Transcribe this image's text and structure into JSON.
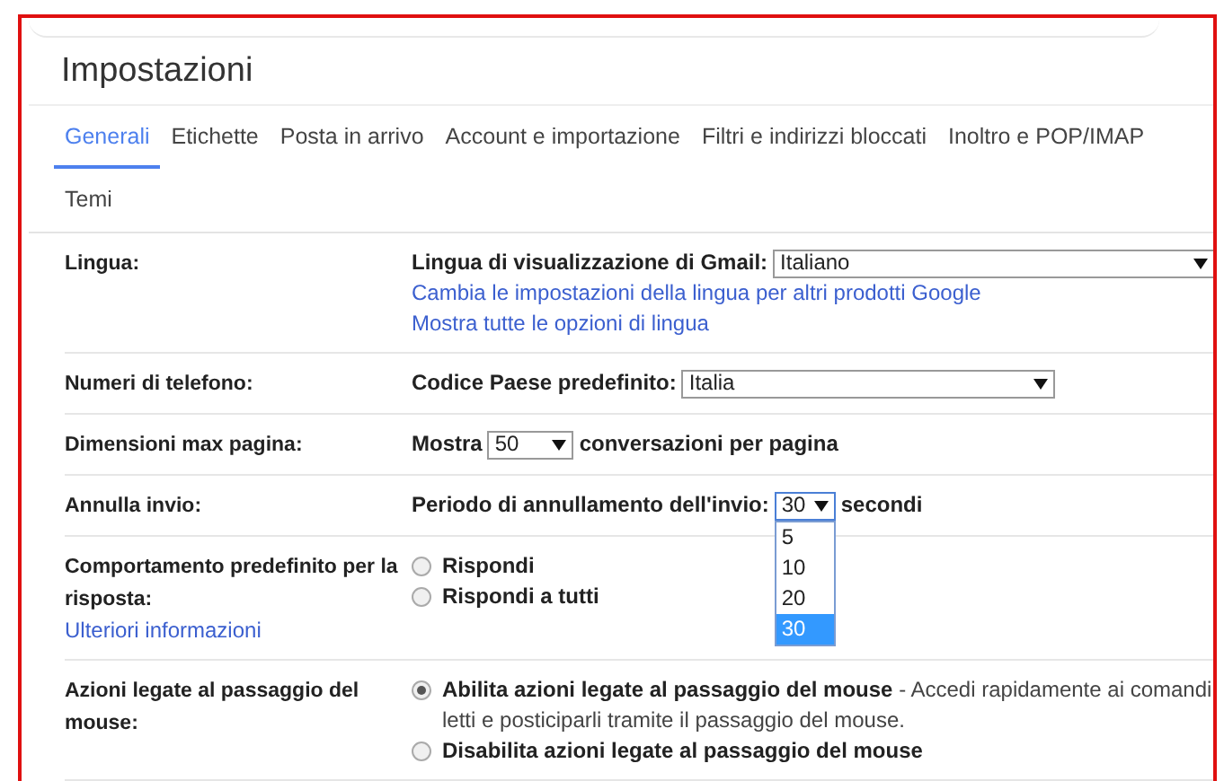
{
  "title": "Impostazioni",
  "tabs": [
    {
      "label": "Generali",
      "selected": true
    },
    {
      "label": "Etichette",
      "selected": false
    },
    {
      "label": "Posta in arrivo",
      "selected": false
    },
    {
      "label": "Account e importazione",
      "selected": false
    },
    {
      "label": "Filtri e indirizzi bloccati",
      "selected": false
    },
    {
      "label": "Inoltro e POP/IMAP",
      "selected": false
    },
    {
      "label": "Temi",
      "selected": false
    }
  ],
  "settings": [
    {
      "kind": "select",
      "label": "Lingua:",
      "field_label": "Lingua di visualizzazione di Gmail:",
      "value": "Italiano",
      "links": [
        "Cambia le impostazioni della lingua per altri prodotti Google",
        "Mostra tutte le opzioni di lingua"
      ]
    },
    {
      "kind": "select",
      "label": "Numeri di telefono:",
      "field_label": "Codice Paese predefinito:",
      "value": "Italia"
    },
    {
      "kind": "select",
      "label": "Dimensioni max pagina:",
      "field_label": "Mostra",
      "value": "50",
      "suffix": "conversazioni per pagina"
    },
    {
      "kind": "select",
      "label": "Annulla invio:",
      "field_label": "Periodo di annullamento dell'invio:",
      "value": "30",
      "suffix": "secondi",
      "expanded": true,
      "options": [
        {
          "label": "5",
          "selected": false
        },
        {
          "label": "10",
          "selected": false
        },
        {
          "label": "20",
          "selected": false
        },
        {
          "label": "30",
          "selected": true
        }
      ]
    },
    {
      "kind": "radio",
      "label": "Comportamento predefinito per la risposta:",
      "label_link": "Ulteriori informazioni",
      "choices": [
        {
          "label": "Rispondi",
          "selected": false
        },
        {
          "label": "Rispondi a tutti",
          "selected": false
        }
      ]
    },
    {
      "kind": "radio",
      "label": "Azioni legate al passaggio del mouse:",
      "choices": [
        {
          "label": "Abilita azioni legate al passaggio del mouse",
          "note": "- Accedi rapidamente ai comandi",
          "detail": "letti e posticiparli tramite il passaggio del mouse.",
          "selected": true
        },
        {
          "label": "Disabilita azioni legate al passaggio del mouse",
          "selected": false
        }
      ]
    }
  ]
}
